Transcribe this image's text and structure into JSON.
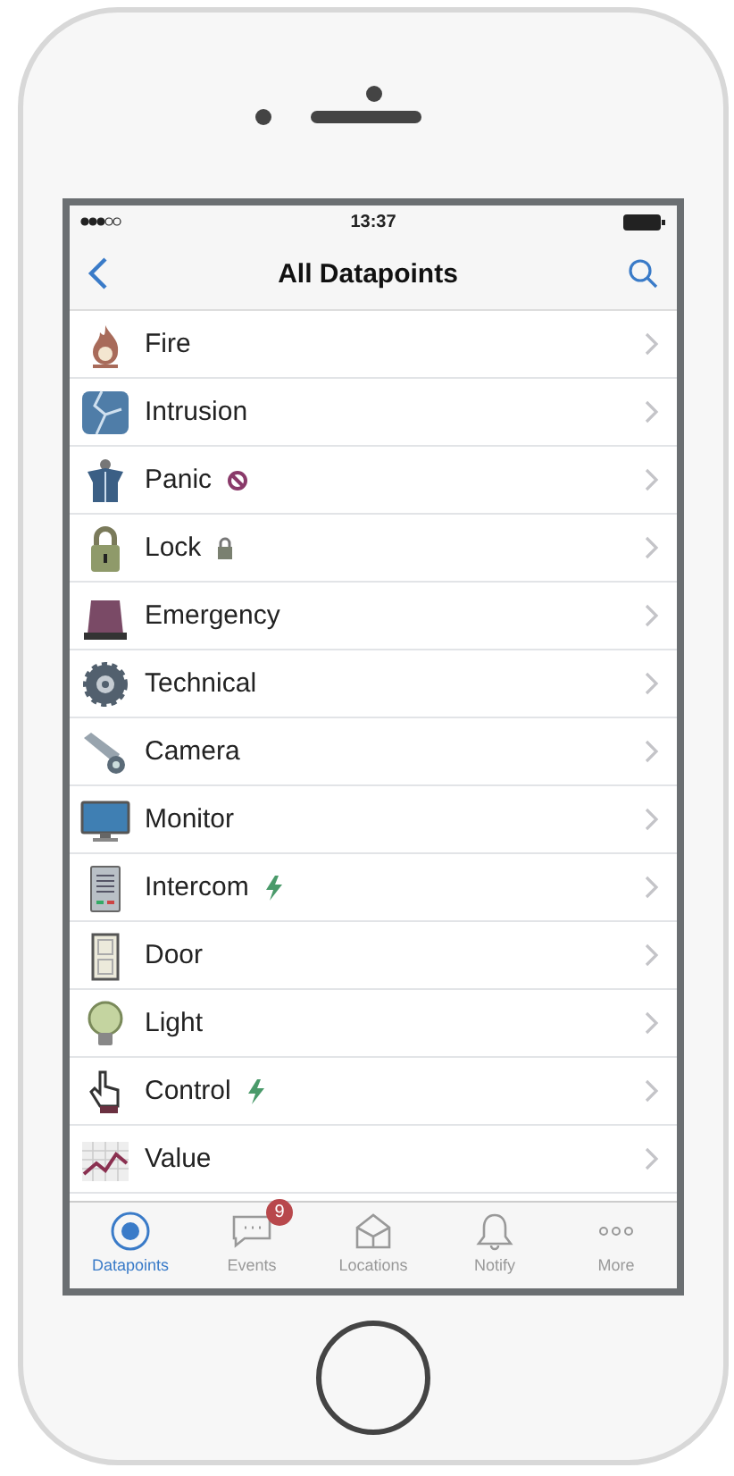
{
  "status_bar": {
    "time": "13:37"
  },
  "nav_bar": {
    "title": "All Datapoints"
  },
  "datapoints": [
    {
      "label": "Fire",
      "blocked": false,
      "locked": false,
      "manual": false
    },
    {
      "label": "Intrusion",
      "blocked": false,
      "locked": false,
      "manual": false
    },
    {
      "label": "Panic",
      "blocked": true,
      "locked": false,
      "manual": false
    },
    {
      "label": "Lock",
      "blocked": false,
      "locked": true,
      "manual": false
    },
    {
      "label": "Emergency",
      "blocked": false,
      "locked": false,
      "manual": false
    },
    {
      "label": "Technical",
      "blocked": false,
      "locked": false,
      "manual": false
    },
    {
      "label": "Camera",
      "blocked": false,
      "locked": false,
      "manual": false
    },
    {
      "label": "Monitor",
      "blocked": false,
      "locked": false,
      "manual": false
    },
    {
      "label": "Intercom",
      "blocked": false,
      "locked": false,
      "manual": true
    },
    {
      "label": "Door",
      "blocked": false,
      "locked": false,
      "manual": false
    },
    {
      "label": "Light",
      "blocked": false,
      "locked": false,
      "manual": false
    },
    {
      "label": "Control",
      "blocked": false,
      "locked": false,
      "manual": true
    },
    {
      "label": "Value",
      "blocked": false,
      "locked": false,
      "manual": false
    }
  ],
  "tabs": [
    {
      "label": "Datapoints",
      "selected": true
    },
    {
      "label": "Events",
      "selected": false,
      "badge": "9"
    },
    {
      "label": "Locations",
      "selected": false
    },
    {
      "label": "Notify",
      "selected": false
    },
    {
      "label": "More",
      "selected": false
    }
  ]
}
